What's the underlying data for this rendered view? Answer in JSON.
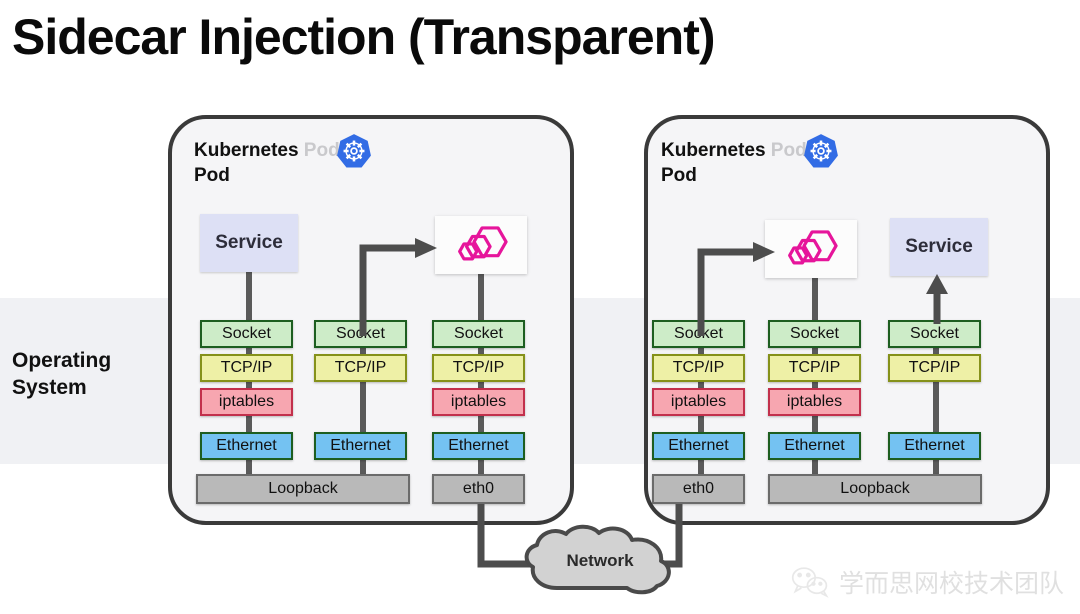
{
  "title": "Sidecar Injection (Transparent)",
  "os_label": "Operating\nSystem",
  "os_label_line1": "Operating",
  "os_label_line2": "System",
  "colors": {
    "socket_fill": "#cdecc8",
    "socket_border": "#1d5e20",
    "tcpip_fill": "#eef0a6",
    "tcpip_border": "#85911a",
    "iptables_fill": "#f7a6b0",
    "iptables_border": "#c2304c",
    "ethernet_fill": "#74c2f2",
    "ethernet_border": "#1d5e20",
    "interface_fill": "#b9b9b9",
    "interface_border": "#6b6b6b",
    "service_fill": "#dde0f5",
    "pod_fill": "#f5f5f7",
    "pod_border": "#3a3a3a",
    "os_band_fill": "#f0f1f4",
    "envoy_logo": "#e6159b",
    "k8s_logo": "#326ce5",
    "connector": "#5a5a5a"
  },
  "pods": [
    {
      "id": "pod-left",
      "title_line1": "Kubernetes",
      "title_line2": "Pod",
      "ghost_text": "Kubernetes Pod",
      "logo_icon": "kubernetes-icon",
      "app_box": {
        "label": "Service",
        "type": "service"
      },
      "proxy_box": {
        "label": "",
        "type": "envoy",
        "icon": "envoy-logo-icon"
      },
      "columns": [
        {
          "id": "col-app",
          "layers": [
            "Socket",
            "TCP/IP",
            "iptables",
            "Ethernet"
          ]
        },
        {
          "id": "col-proxy",
          "layers": [
            "Socket",
            "TCP/IP",
            "Ethernet"
          ]
        },
        {
          "id": "col-net",
          "layers": [
            "Socket",
            "TCP/IP",
            "iptables",
            "Ethernet"
          ]
        }
      ],
      "interfaces": [
        {
          "label": "Loopback",
          "spans": "col-app,col-proxy"
        },
        {
          "label": "eth0",
          "spans": "col-net"
        }
      ]
    },
    {
      "id": "pod-right",
      "title_line1": "Kubernetes",
      "title_line2": "Pod",
      "ghost_text": "Kubernetes Pod",
      "logo_icon": "kubernetes-icon",
      "app_box": {
        "label": "Service",
        "type": "service"
      },
      "proxy_box": {
        "label": "",
        "type": "envoy",
        "icon": "envoy-logo-icon"
      },
      "columns": [
        {
          "id": "col-net",
          "layers": [
            "Socket",
            "TCP/IP",
            "iptables",
            "Ethernet"
          ]
        },
        {
          "id": "col-proxy",
          "layers": [
            "Socket",
            "TCP/IP",
            "iptables",
            "Ethernet"
          ]
        },
        {
          "id": "col-app",
          "layers": [
            "Socket",
            "TCP/IP",
            "Ethernet"
          ]
        }
      ],
      "interfaces": [
        {
          "label": "eth0",
          "spans": "col-net"
        },
        {
          "label": "Loopback",
          "spans": "col-proxy,col-app"
        }
      ]
    }
  ],
  "network": {
    "label": "Network",
    "icon": "cloud-icon"
  },
  "watermark": {
    "text": "学而思网校技术团队",
    "icon": "wechat-icon"
  }
}
